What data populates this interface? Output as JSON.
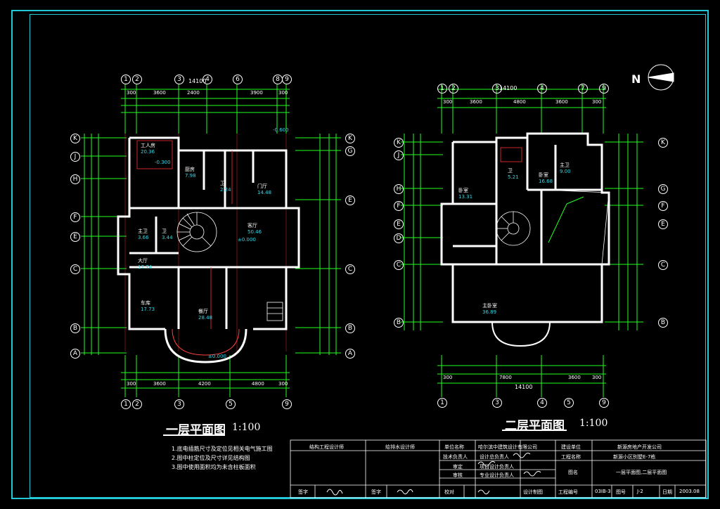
{
  "drawing": {
    "plan1_title": "一层平面图",
    "plan1_scale": "1:100",
    "plan2_title": "二层平面图",
    "plan2_scale": "1:100",
    "north_label": "N",
    "notes": [
      "1.底电插筋尺寸及定位见相关电气施工图",
      "2.图中柱定位及尺寸详见结构图",
      "3.图中使用面积均为未含柱板面积"
    ],
    "plan1": {
      "dims_top_total": "14100",
      "dims_top": [
        "300",
        "3600",
        "2400",
        "3900",
        "300"
      ],
      "dims_bottom": [
        "300",
        "3600",
        "4200",
        "4800",
        "300"
      ],
      "axes_top": [
        "1",
        "2",
        "3",
        "4",
        "6",
        "8",
        "9"
      ],
      "axes_bottom": [
        "1",
        "2",
        "3",
        "5",
        "9"
      ],
      "axes_left": [
        "K",
        "J",
        "H",
        "F",
        "E",
        "C",
        "B",
        "A"
      ],
      "axes_right": [
        "K",
        "G",
        "E",
        "C",
        "B",
        "A"
      ],
      "rooms": [
        {
          "name": "工人房",
          "area": "20.36"
        },
        {
          "name": "厨房",
          "area": "7.98"
        },
        {
          "name": "卫",
          "area": "2.24"
        },
        {
          "name": "门厅",
          "area": "14.48"
        },
        {
          "name": "客厅",
          "area": "50.46"
        },
        {
          "name": "车库",
          "area": "17.73"
        },
        {
          "name": "餐厅",
          "area": "28.48"
        },
        {
          "name": "主卫",
          "area": "3.66"
        },
        {
          "name": "卫",
          "area": "3.44"
        },
        {
          "name": "大厅",
          "area": "17.74"
        }
      ],
      "elevations": [
        "±0.000",
        "-0.300",
        "-0.600",
        "±0.000"
      ]
    },
    "plan2": {
      "dims_top_total": "14100",
      "dims_top": [
        "300",
        "3600",
        "4800",
        "3600",
        "300"
      ],
      "dims_bottom_total": "14100",
      "dims_bottom": [
        "300",
        "7800",
        "3600",
        "300"
      ],
      "axes_top": [
        "1",
        "2",
        "3",
        "4",
        "7",
        "9"
      ],
      "axes_bottom": [
        "1",
        "3",
        "4",
        "5",
        "9"
      ],
      "axes_left": [
        "K",
        "J",
        "H",
        "F",
        "E",
        "D",
        "C",
        "B"
      ],
      "axes_right": [
        "K",
        "G",
        "F",
        "E",
        "C",
        "B"
      ],
      "rooms": [
        {
          "name": "卧室",
          "area": "13.31"
        },
        {
          "name": "卫",
          "area": "5.21"
        },
        {
          "name": "卧室",
          "area": "16.68"
        },
        {
          "name": "主卧室",
          "area": "36.89"
        },
        {
          "name": "主卫",
          "area": "9.00"
        }
      ]
    },
    "title_block": {
      "r1": [
        "结构工程设计师",
        "给排水设计师",
        "单位名称",
        "哈尔滨中建筑设计有限公司",
        "建设单位",
        "新源房地产开发公司"
      ],
      "r2": [
        "技术负责人",
        "设计总负责人",
        "工程名称",
        "新源小区别墅E-7栋"
      ],
      "r3": [
        "审定",
        "项目设计负责人",
        "图名",
        "一层平面图,二层平面图"
      ],
      "r4": [
        "审核",
        "专业设计负责人"
      ],
      "r5": [
        "签字",
        "签字",
        "校对",
        "设计制图",
        "工程编号",
        "03IB-3",
        "图号",
        "J-2",
        "日期",
        "2003.08"
      ]
    }
  }
}
